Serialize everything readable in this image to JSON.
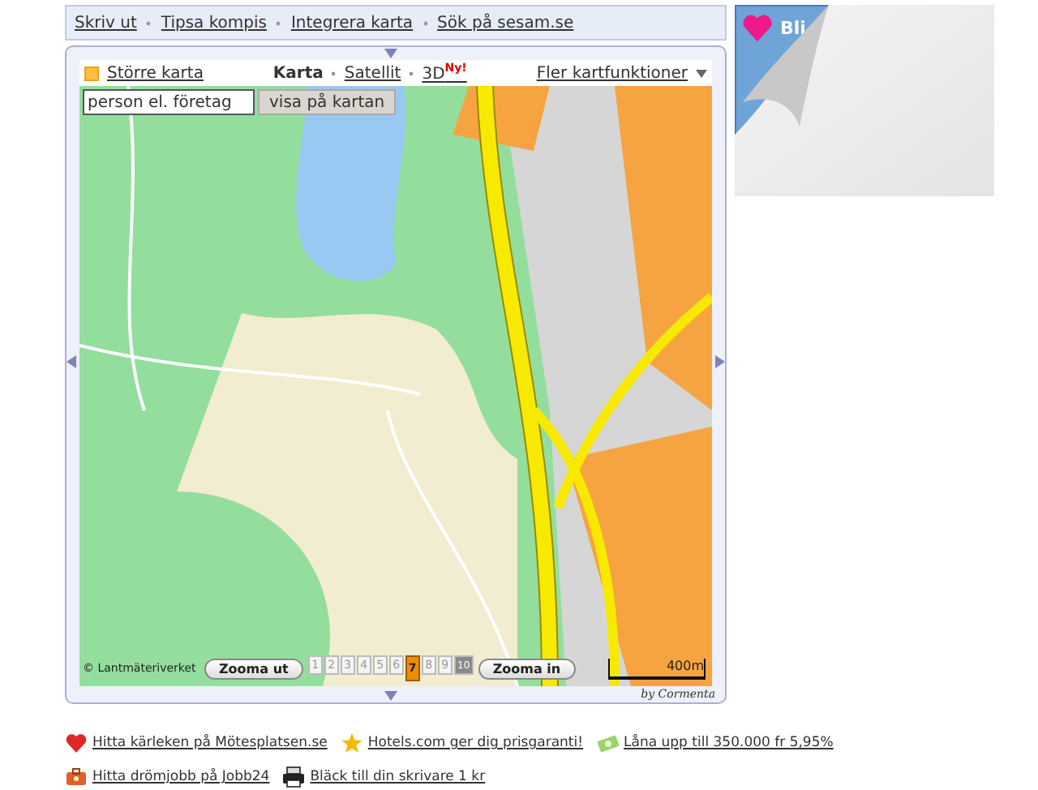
{
  "top_links": [
    "Skriv ut",
    "Tipsa kompis",
    "Integrera karta",
    "Sök på sesam.se"
  ],
  "map_toolbar": {
    "larger_map": "Större karta",
    "view_tabs": [
      {
        "label": "Karta",
        "selected": true
      },
      {
        "label": "Satellit",
        "selected": false
      },
      {
        "label": "3D",
        "badge": "Ny!",
        "selected": false
      }
    ],
    "more": "Fler kartfunktioner"
  },
  "search": {
    "value": "person el. företag",
    "button": "visa på kartan"
  },
  "copyright": "© Lantmäteriverket",
  "zoom": {
    "out": "Zooma ut",
    "in": "Zooma in",
    "levels": [
      {
        "label": "1",
        "selected": false,
        "disabled": false
      },
      {
        "label": "2",
        "selected": false,
        "disabled": false
      },
      {
        "label": "3",
        "selected": false,
        "disabled": false
      },
      {
        "label": "4",
        "selected": false,
        "disabled": false
      },
      {
        "label": "5",
        "selected": false,
        "disabled": false
      },
      {
        "label": "6",
        "selected": false,
        "disabled": false
      },
      {
        "label": "7",
        "selected": true,
        "disabled": false
      },
      {
        "label": "8",
        "selected": false,
        "disabled": false
      },
      {
        "label": "9",
        "selected": false,
        "disabled": false
      },
      {
        "label": "10",
        "selected": false,
        "disabled": true
      }
    ]
  },
  "scale": "400m",
  "credit": "by Cormenta",
  "ad": {
    "text": "Bli"
  },
  "promo_links": [
    {
      "kind": "heart",
      "text": "Hitta kärleken på Mötesplatsen.se"
    },
    {
      "kind": "star",
      "text": "Hotels.com ger dig prisgaranti!"
    },
    {
      "kind": "money",
      "text": "Låna upp till 350.000 fr 5,95%"
    },
    {
      "kind": "briefcase",
      "text": "Hitta drömjobb på Jobb24"
    },
    {
      "kind": "printer",
      "text": "Bläck till din skrivare 1 kr"
    }
  ]
}
